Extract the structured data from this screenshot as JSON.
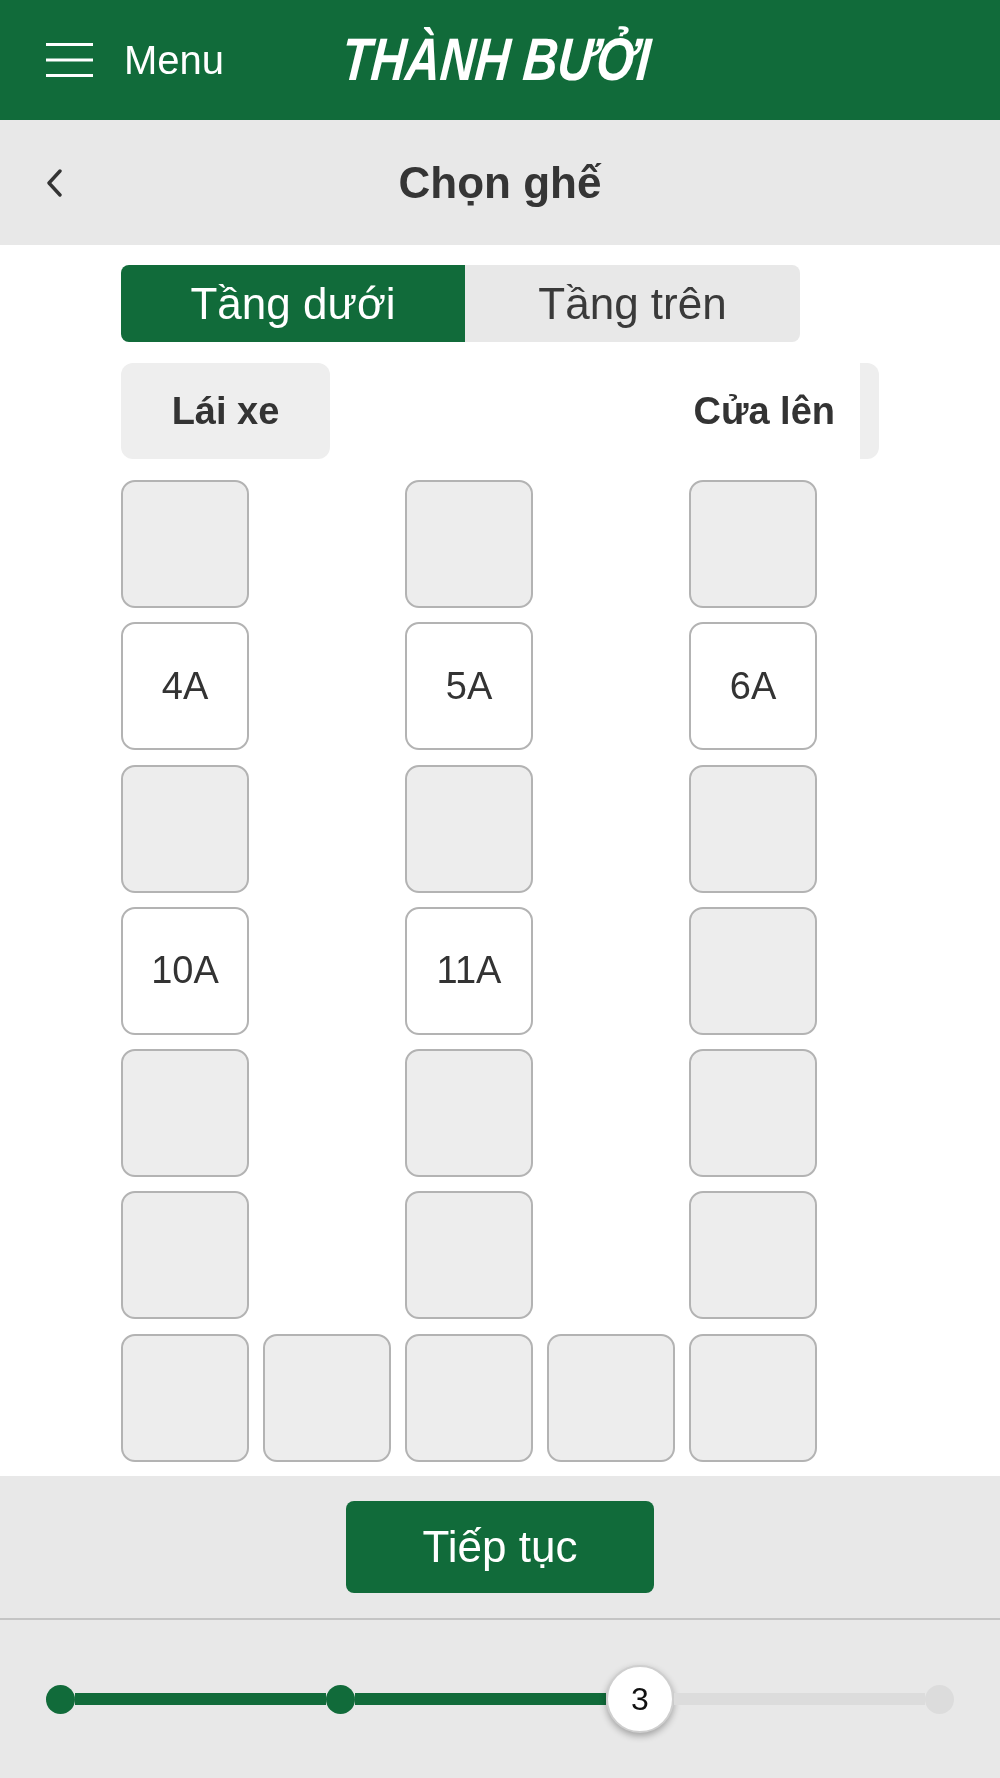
{
  "header": {
    "menu_label": "Menu",
    "logo": "THÀNH BƯỞI"
  },
  "page_header": {
    "title": "Chọn ghế"
  },
  "deck_tabs": [
    {
      "label": "Tầng dưới",
      "selected": true
    },
    {
      "label": "Tầng trên",
      "selected": false
    }
  ],
  "seat_map": {
    "driver_label": "Lái xe",
    "door_label": "Cửa lên",
    "rows": [
      {
        "cells": [
          {
            "kind": "unavailable"
          },
          {
            "kind": "aisle"
          },
          {
            "kind": "unavailable"
          },
          {
            "kind": "aisle"
          },
          {
            "kind": "unavailable"
          }
        ]
      },
      {
        "cells": [
          {
            "kind": "seat",
            "label": "4A"
          },
          {
            "kind": "aisle"
          },
          {
            "kind": "seat",
            "label": "5A"
          },
          {
            "kind": "aisle"
          },
          {
            "kind": "seat",
            "label": "6A"
          }
        ]
      },
      {
        "cells": [
          {
            "kind": "unavailable"
          },
          {
            "kind": "aisle"
          },
          {
            "kind": "unavailable"
          },
          {
            "kind": "aisle"
          },
          {
            "kind": "unavailable"
          }
        ]
      },
      {
        "cells": [
          {
            "kind": "seat",
            "label": "10A"
          },
          {
            "kind": "aisle"
          },
          {
            "kind": "seat",
            "label": "11A"
          },
          {
            "kind": "aisle"
          },
          {
            "kind": "unavailable"
          }
        ]
      },
      {
        "cells": [
          {
            "kind": "unavailable"
          },
          {
            "kind": "aisle"
          },
          {
            "kind": "unavailable"
          },
          {
            "kind": "aisle"
          },
          {
            "kind": "unavailable"
          }
        ]
      },
      {
        "cells": [
          {
            "kind": "unavailable"
          },
          {
            "kind": "aisle"
          },
          {
            "kind": "unavailable"
          },
          {
            "kind": "aisle"
          },
          {
            "kind": "unavailable"
          }
        ]
      },
      {
        "cells": [
          {
            "kind": "unavailable"
          },
          {
            "kind": "unavailable"
          },
          {
            "kind": "unavailable"
          },
          {
            "kind": "unavailable"
          },
          {
            "kind": "unavailable"
          }
        ]
      }
    ]
  },
  "continue_button": {
    "label": "Tiếp tục"
  },
  "progress_steps": [
    {
      "kind": "done"
    },
    {
      "kind": "done"
    },
    {
      "kind": "current",
      "label": "3"
    },
    {
      "kind": "pending"
    }
  ]
}
